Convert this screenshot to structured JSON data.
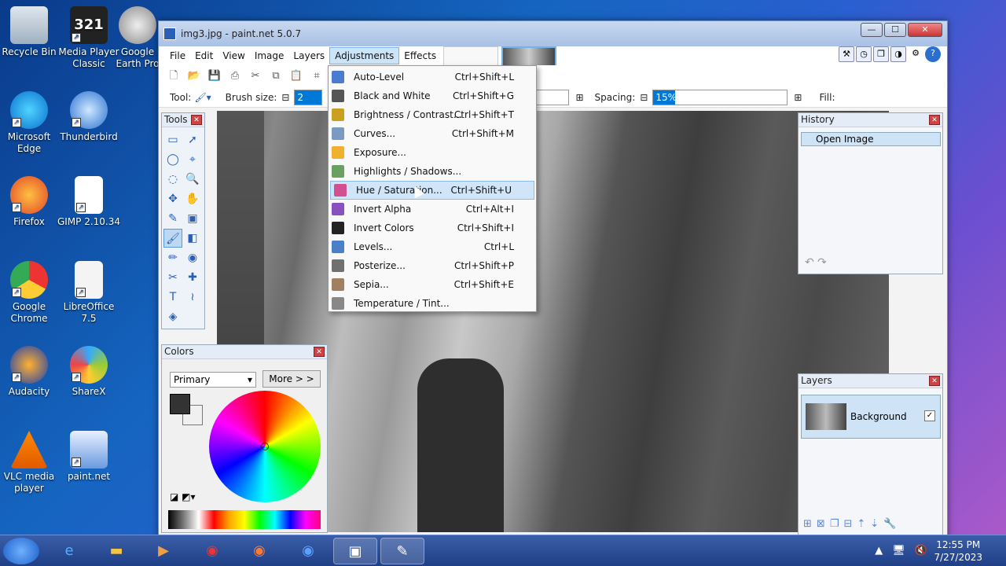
{
  "desktop": {
    "icons": [
      {
        "label": "Recycle Bin",
        "icon": "recycle-bin-icon"
      },
      {
        "label": "Media Player Classic",
        "icon": "mpc-icon"
      },
      {
        "label": "Google Earth Pro",
        "icon": "google-earth-icon"
      },
      {
        "label": "Microsoft Edge",
        "icon": "edge-icon"
      },
      {
        "label": "Thunderbird",
        "icon": "thunderbird-icon"
      },
      {
        "label": "Firefox",
        "icon": "firefox-icon"
      },
      {
        "label": "GIMP 2.10.34",
        "icon": "file-icon"
      },
      {
        "label": "Google Chrome",
        "icon": "chrome-icon"
      },
      {
        "label": "LibreOffice 7.5",
        "icon": "libreoffice-icon"
      },
      {
        "label": "Audacity",
        "icon": "audacity-icon"
      },
      {
        "label": "ShareX",
        "icon": "sharex-icon"
      },
      {
        "label": "VLC media player",
        "icon": "vlc-icon"
      },
      {
        "label": "paint.net",
        "icon": "paintnet-icon"
      }
    ]
  },
  "window": {
    "title": "img3.jpg - paint.net 5.0.7",
    "controls": {
      "minimize": "—",
      "maximize": "☐",
      "close": "✕"
    }
  },
  "menubar": [
    "File",
    "Edit",
    "View",
    "Image",
    "Layers",
    "Adjustments",
    "Effects"
  ],
  "toolbar2": {
    "tool_label": "Tool:",
    "brush_size_label": "Brush size:",
    "brush_size_value": "2",
    "spacing_label": "Spacing:",
    "spacing_value": "15%",
    "fill_label": "Fill:"
  },
  "adjustments_menu": [
    {
      "label": "Auto-Level",
      "shortcut": "Ctrl+Shift+L",
      "color": "#4a7bd0"
    },
    {
      "label": "Black and White",
      "shortcut": "Ctrl+Shift+G",
      "color": "#555555"
    },
    {
      "label": "Brightness / Contrast...",
      "shortcut": "Ctrl+Shift+T",
      "color": "#c9a020"
    },
    {
      "label": "Curves...",
      "shortcut": "Ctrl+Shift+M",
      "color": "#7a9ac0"
    },
    {
      "label": "Exposure...",
      "shortcut": "",
      "color": "#f0b030"
    },
    {
      "label": "Highlights / Shadows...",
      "shortcut": "",
      "color": "#6aa060"
    },
    {
      "label": "Hue / Saturation...",
      "shortcut": "Ctrl+Shift+U",
      "color": "#d05090"
    },
    {
      "label": "Invert Alpha",
      "shortcut": "Ctrl+Alt+I",
      "color": "#8a50c0"
    },
    {
      "label": "Invert Colors",
      "shortcut": "Ctrl+Shift+I",
      "color": "#222222"
    },
    {
      "label": "Levels...",
      "shortcut": "Ctrl+L",
      "color": "#4a80c8"
    },
    {
      "label": "Posterize...",
      "shortcut": "Ctrl+Shift+P",
      "color": "#707070"
    },
    {
      "label": "Sepia...",
      "shortcut": "Ctrl+Shift+E",
      "color": "#a08060"
    },
    {
      "label": "Temperature / Tint...",
      "shortcut": "",
      "color": "#888888"
    }
  ],
  "tools_panel": {
    "title": "Tools",
    "tools": [
      "▭",
      "➚",
      "◯",
      "⌖",
      "◌",
      "🔍",
      "✥",
      "✋",
      "✎",
      "▣",
      "🖌",
      "◧",
      "✏",
      "◉",
      "✂",
      "✚",
      "T",
      "≀",
      "◈",
      ""
    ]
  },
  "colors_panel": {
    "title": "Colors",
    "mode": "Primary",
    "more_label": "More > >"
  },
  "history_panel": {
    "title": "History",
    "items": [
      "Open Image"
    ]
  },
  "layers_panel": {
    "title": "Layers",
    "layers": [
      {
        "name": "Background",
        "visible": "✓"
      }
    ]
  },
  "taskbar": {
    "time": "12:55 PM",
    "date": "7/27/2023"
  }
}
